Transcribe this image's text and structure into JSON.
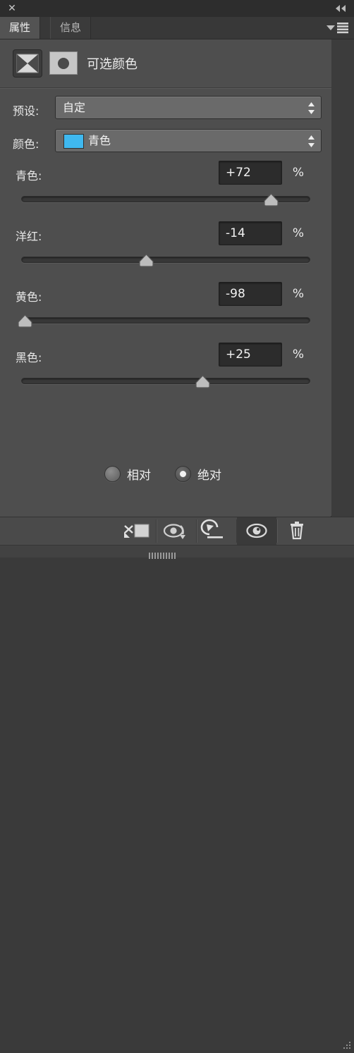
{
  "window": {
    "close_label": "✕",
    "collapse_icon": "double-chevron-left"
  },
  "tabs": [
    {
      "label": "属性",
      "active": true
    },
    {
      "label": "信息",
      "active": false
    }
  ],
  "panel_menu_icon": "hamburger-menu",
  "adjustment": {
    "title": "可选颜色",
    "layer_icon": "selective-color-adjustment-icon",
    "mask_icon": "layer-mask-thumbnail"
  },
  "fields": {
    "preset": {
      "label": "预设:",
      "value": "自定"
    },
    "colors": {
      "label": "颜色:",
      "value": "青色",
      "swatch_hex": "#3fb8ef"
    }
  },
  "sliders": [
    {
      "label": "青色:",
      "value": "+72",
      "unit": "%",
      "percent": 86.0,
      "min": -100,
      "max": 100,
      "number": 72
    },
    {
      "label": "洋红:",
      "value": "-14",
      "unit": "%",
      "percent": 43.0,
      "min": -100,
      "max": 100,
      "number": -14
    },
    {
      "label": "黄色:",
      "value": "-98",
      "unit": "%",
      "percent": 1.0,
      "min": -100,
      "max": 100,
      "number": -98
    },
    {
      "label": "黑色:",
      "value": "+25",
      "unit": "%",
      "percent": 62.5,
      "min": -100,
      "max": 100,
      "number": 25
    }
  ],
  "method": {
    "options": [
      {
        "label": "相对",
        "selected": false
      },
      {
        "label": "绝对",
        "selected": true
      }
    ]
  },
  "toolbar": {
    "buttons": [
      {
        "icon": "clip-to-layer-icon",
        "active": false
      },
      {
        "icon": "toggle-previous-state-eye-icon",
        "active": false
      },
      {
        "icon": "reset-adjustment-icon",
        "active": false
      },
      {
        "icon": "toggle-layer-visibility-eye-icon",
        "active": true
      },
      {
        "icon": "delete-trash-icon",
        "active": false
      }
    ],
    "resize_grip_icon": "resize-grip-icon",
    "drag_grip_icon": "drag-grip-icon"
  },
  "colors": {
    "panel_bg": "#4e4e4e",
    "titlebar_bg": "#2d2d2d",
    "tab_active_bg": "#535353",
    "tab_inactive_bg": "#3b3b3b",
    "input_bg": "#2c2c2c",
    "combo_bg": "#6a6a6a",
    "text": "#ededed",
    "accent_swatch": "#3fb8ef"
  }
}
